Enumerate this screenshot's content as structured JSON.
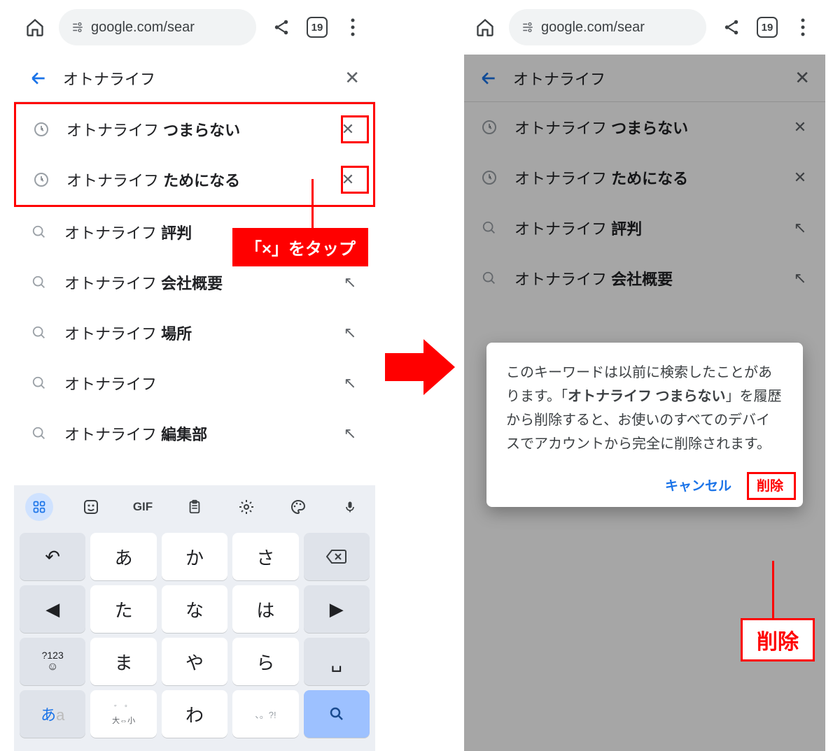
{
  "toolbar": {
    "url": "google.com/sear",
    "tab_count": "19"
  },
  "search": {
    "query": "オトナライフ"
  },
  "suggestions": [
    {
      "base": "オトナライフ ",
      "bold": "つまらない",
      "type": "history"
    },
    {
      "base": "オトナライフ ",
      "bold": "ためになる",
      "type": "history"
    },
    {
      "base": "オトナライフ ",
      "bold": "評判",
      "type": "search"
    },
    {
      "base": "オトナライフ ",
      "bold": "会社概要",
      "type": "search"
    },
    {
      "base": "オトナライフ ",
      "bold": "場所",
      "type": "search"
    },
    {
      "base": "オトナライフ",
      "bold": "",
      "type": "search"
    },
    {
      "base": "オトナライフ ",
      "bold": "編集部",
      "type": "search"
    }
  ],
  "annotation": {
    "tap_x": "「×」をタップ",
    "delete_label": "削除"
  },
  "dialog": {
    "text_before": "このキーワードは以前に検索したことがあります。「",
    "keyword": "オトナライフ つまらない",
    "text_after": "」を履歴から削除すると、お使いのすべてのデバイスでアカウントから完全に削除されます。",
    "cancel": "キャンセル",
    "delete": "削除"
  },
  "keyboard": {
    "rows": [
      [
        "↶",
        "あ",
        "か",
        "さ",
        "⌫"
      ],
      [
        "◀",
        "た",
        "な",
        "は",
        "▶"
      ],
      [
        "?123",
        "ま",
        "や",
        "ら",
        "␣"
      ],
      [
        "あa",
        "大⇔小",
        "わ",
        "、。?!",
        "🔍"
      ]
    ],
    "symbol_key": "?123",
    "emoji_in_row3": "☺"
  }
}
